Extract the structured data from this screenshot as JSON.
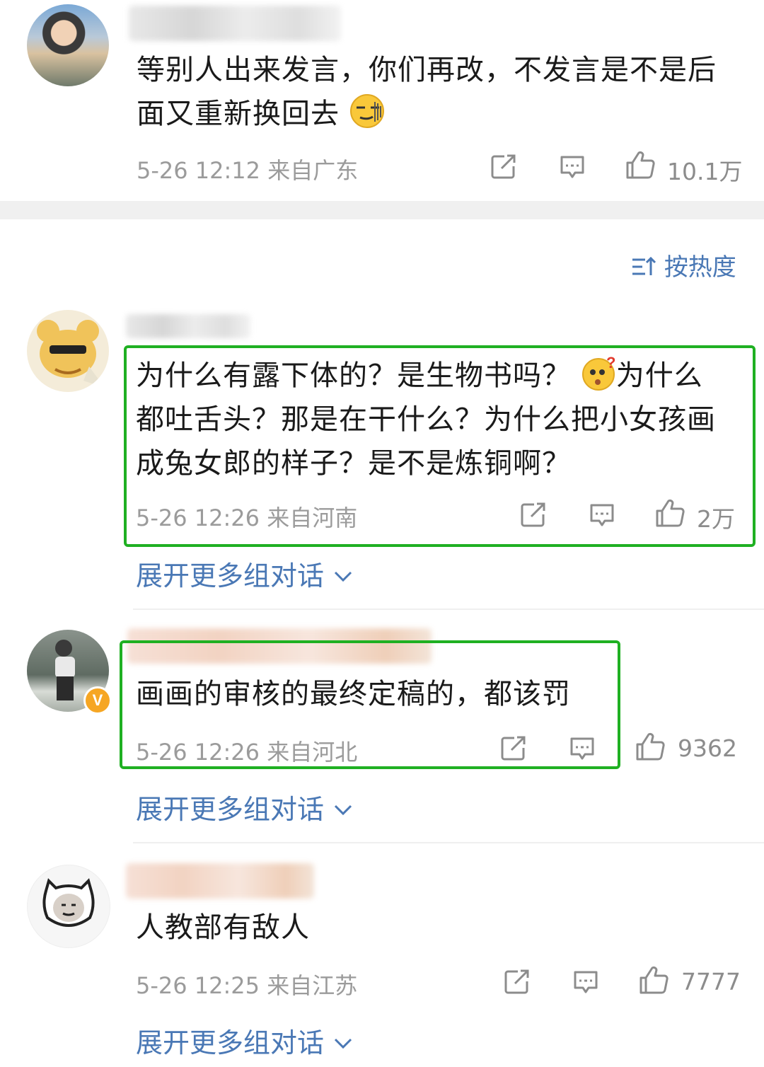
{
  "sort": {
    "label": "按热度"
  },
  "comments": [
    {
      "text_line1": "等别人出来发言，你们再改，不发言是不是后",
      "text_line2": "面又重新换回去",
      "time": "5-26 12:12",
      "location": "来自广东",
      "likes": "10.1万"
    },
    {
      "text_line1": "为什么有露下体的？是生物书吗？",
      "text_line1b": "为什么",
      "text_line2": "都吐舌头？那是在干什么？为什么把小女孩画",
      "text_line3": "成兔女郎的样子？是不是炼铜啊？",
      "time": "5-26 12:26",
      "location": "来自河南",
      "likes": "2万",
      "expand": "展开更多组对话"
    },
    {
      "text": "画画的审核的最终定稿的，都该罚",
      "time": "5-26 12:26",
      "location": "来自河北",
      "likes": "9362",
      "expand": "展开更多组对话",
      "verified_badge": "V"
    },
    {
      "text": "人教部有敌人",
      "time": "5-26 12:25",
      "location": "来自江苏",
      "likes": "7777",
      "expand": "展开更多组对话"
    }
  ],
  "colors": {
    "highlight": "#1fb022",
    "link": "#4a78b5",
    "meta": "#9b9b9b"
  }
}
